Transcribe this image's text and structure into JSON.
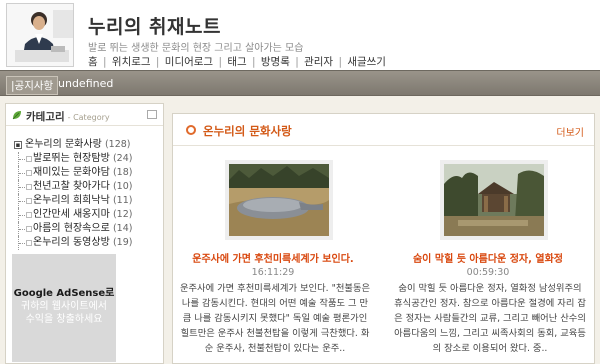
{
  "header": {
    "title": "누리의 취재노트",
    "subtitle": "발로 뛰는 생생한 문화의 현장 그리고 살아가는 모습",
    "nav": [
      "홈",
      "위치로그",
      "미디어로그",
      "태그",
      "방명록",
      "관리자",
      "새글쓰기"
    ],
    "nav_separator": "|"
  },
  "notice": {
    "label": "|공지사항",
    "text": "undefined"
  },
  "sidebar": {
    "title": "카테고리",
    "title_en": "- Category",
    "root": {
      "label": "온누리의 문화사랑",
      "count": "(128)"
    },
    "items": [
      {
        "label": "발로뛰는 현장탐방",
        "count": "(24)"
      },
      {
        "label": "재미있는 문화야담",
        "count": "(18)"
      },
      {
        "label": "천년고찰 찾아가다",
        "count": "(10)"
      },
      {
        "label": "온누리의 희희낙낙",
        "count": "(11)"
      },
      {
        "label": "인간만세 새옹지마",
        "count": "(12)"
      },
      {
        "label": "아름의 현장속으로",
        "count": "(14)"
      },
      {
        "label": "온누리의 동영상방",
        "count": "(19)"
      }
    ],
    "ad": {
      "title": "Google AdSense로",
      "line2": "귀하의 웹사이트에서",
      "line3": "수익을 창출하세요"
    }
  },
  "main": {
    "title": "온누리의 문화사랑",
    "more": "더보기",
    "posts": [
      {
        "title": "운주사에 가면 후천미륵세계가 보인다.",
        "time": "16:11:29",
        "body": "운주사에 가면 후천미륵세계가 보인다. \"천불동은 나를 감동시킨다. 현대의 어떤 예술 작품도 그 만큼 나를 감동시키지 못했다\" 독일 예술 평론가인 힐트만은 운주사 천불천탑을 이렇게 극찬했다. 화순 운주사, 천불천탑이 있다는 운주.."
      },
      {
        "title": "숨이 막힐 듯 아름다운 정자, 열화정",
        "time": "00:59:30",
        "body": "숨이 막힐 듯 아름다운 정자, 열화정 남성위주의 휴식공간인 정자. 참으로 아름다운 절경에 자리 잡은 정자는 사람들간의 교류, 그리고 빼어난 산수의 아름다움의 느낌, 그리고 씨족사회의 동회, 교육등의 장소로 이용되어 왔다. 중.."
      }
    ]
  },
  "colors": {
    "accent": "#d35a18",
    "notice_bar": "#8a847a",
    "background": "#f3f0e8"
  }
}
